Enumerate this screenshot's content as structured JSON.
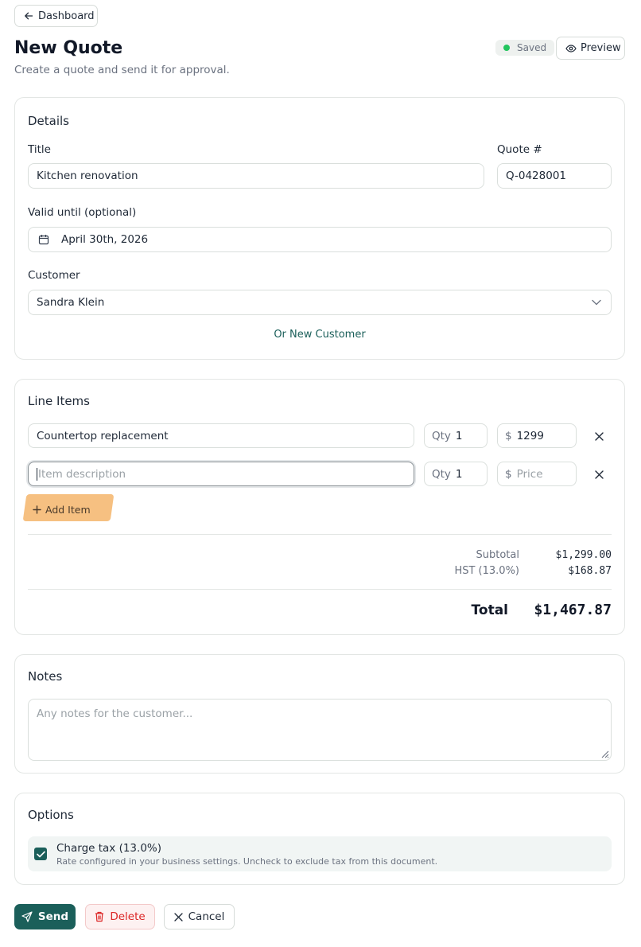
{
  "nav": {
    "back_label": "Dashboard"
  },
  "header": {
    "title": "New Quote",
    "subtitle": "Create a quote and send it for approval.",
    "status_badge": "Saved",
    "preview_label": "Preview"
  },
  "details": {
    "section_title": "Details",
    "title_label": "Title",
    "title_value": "Kitchen renovation",
    "quote_number_label": "Quote #",
    "quote_number_value": "Q-0428001",
    "valid_until_label": "Valid until (optional)",
    "valid_until_value": "April 30th, 2026",
    "customer_label": "Customer",
    "customer_value": "Sandra Klein",
    "new_customer_link": "Or New Customer"
  },
  "line_items": {
    "section_title": "Line Items",
    "rows": [
      {
        "description": "Countertop replacement",
        "qty_prefix": "Qty",
        "qty": "1",
        "price_prefix": "$",
        "price": "1299"
      },
      {
        "description_placeholder": "Item description",
        "qty_prefix": "Qty",
        "qty": "1",
        "price_prefix": "$",
        "price_placeholder": "Price"
      }
    ],
    "add_item_label": "Add Item",
    "subtotal_label": "Subtotal",
    "subtotal_value": "$1,299.00",
    "tax_label": "HST (13.0%)",
    "tax_value": "$168.87",
    "total_label": "Total",
    "total_value": "$1,467.87"
  },
  "notes": {
    "section_title": "Notes",
    "placeholder": "Any notes for the customer..."
  },
  "options": {
    "section_title": "Options",
    "charge_tax_label": "Charge tax (13.0%)",
    "charge_tax_help": "Rate configured in your business settings. Uncheck to exclude tax from this document.",
    "charge_tax_checked": true
  },
  "actions": {
    "send_label": "Send",
    "delete_label": "Delete",
    "cancel_label": "Cancel"
  },
  "colors": {
    "primary": "#1b5f5a",
    "saved_dot": "#22c55e",
    "delete_text": "#dc2626",
    "highlight": "#f4b56b"
  }
}
